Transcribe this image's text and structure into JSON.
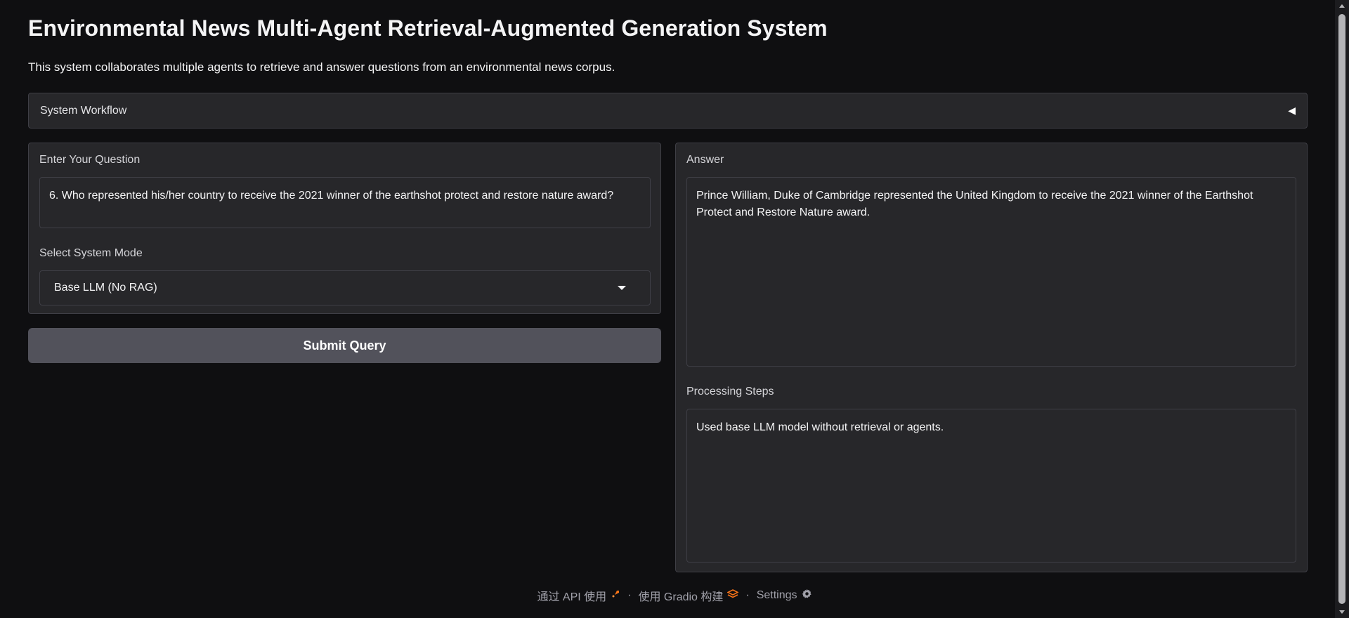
{
  "header": {
    "title": "Environmental News Multi-Agent Retrieval-Augmented Generation System",
    "description": "This system collaborates multiple agents to retrieve and answer questions from an environmental news corpus."
  },
  "workflow": {
    "label": "System Workflow",
    "icon": "collapse-left-triangle"
  },
  "question": {
    "label": "Enter Your Question",
    "value": "6.   Who represented his/her country to receive the 2021 winner of the earthshot protect and restore nature award?"
  },
  "mode": {
    "label": "Select System Mode",
    "selected": "Base LLM (No RAG)"
  },
  "submit": {
    "label": "Submit Query"
  },
  "answer": {
    "label": "Answer",
    "value": "Prince William, Duke of Cambridge represented the United Kingdom to receive the 2021 winner of the Earthshot Protect and Restore Nature award."
  },
  "steps": {
    "label": "Processing Steps",
    "value": "Used base LLM model without retrieval or agents."
  },
  "footer": {
    "api_label": "通过 API 使用",
    "separator": "·",
    "built_label": "使用 Gradio 构建",
    "settings_label": "Settings"
  },
  "colors": {
    "background": "#0f0f11",
    "panel": "#27272a",
    "border": "#3f3f46",
    "button": "#52525b",
    "gradio_orange": "#f97316"
  }
}
